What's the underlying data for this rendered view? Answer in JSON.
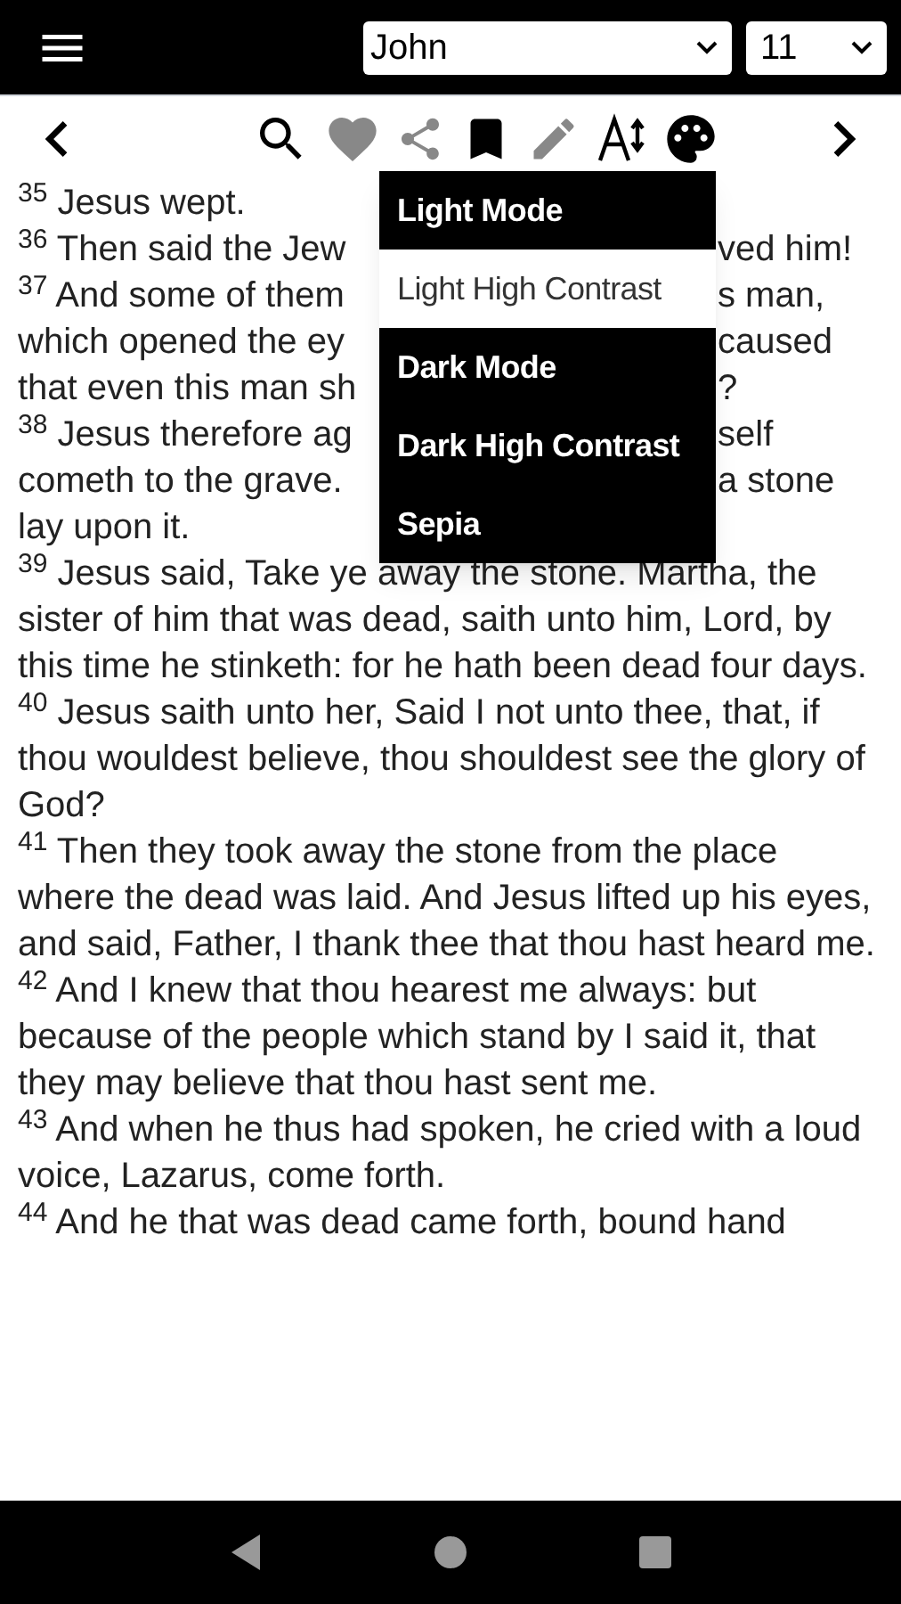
{
  "header": {
    "book_select": {
      "value": "John"
    },
    "chapter_select": {
      "value": "11"
    }
  },
  "toolbar": {
    "favorite": {
      "on": false
    },
    "bookmark": {
      "on": true
    }
  },
  "theme_menu": {
    "items": [
      {
        "label": "Light Mode",
        "selected": false
      },
      {
        "label": "Light High Contrast",
        "selected": true
      },
      {
        "label": "Dark Mode",
        "selected": false
      },
      {
        "label": "Dark High Contrast",
        "selected": false
      },
      {
        "label": "Sepia",
        "selected": false
      }
    ]
  },
  "verses": [
    {
      "kind": "full",
      "text": "$^{35}$ Jesus wept."
    },
    {
      "kind": "covered",
      "lines": [
        {
          "left": "$^{36}$ Then said the Jew",
          "right": "ved him!"
        }
      ]
    },
    {
      "kind": "covered",
      "lines": [
        {
          "left": "$^{37}$ And some of them",
          "right": "s man,"
        },
        {
          "left": "which opened the ey",
          "right": "caused"
        },
        {
          "left": "that even this man sh",
          "right": "?"
        }
      ]
    },
    {
      "kind": "covered",
      "lines": [
        {
          "left": "$^{38}$ Jesus therefore ag",
          "right": "self"
        },
        {
          "left": "cometh to the grave.",
          "right": "a stone"
        },
        {
          "left": "lay upon it."
        }
      ]
    },
    {
      "kind": "full",
      "text": "$^{39}$ Jesus said, Take ye away the stone. Martha, the sister of him that was dead, saith unto him, Lord, by this time he stinketh: for he hath been dead four days."
    },
    {
      "kind": "full",
      "text": "$^{40}$ Jesus saith unto her, Said I not unto thee, that, if thou wouldest believe, thou shouldest see the glory of God?"
    },
    {
      "kind": "full",
      "text": "$^{41}$ Then they took away the stone from the place where the dead was laid. And Jesus lifted up his eyes, and said, Father, I thank thee that thou hast heard me."
    },
    {
      "kind": "full",
      "text": "$^{42}$ And I knew that thou hearest me always: but because of the people which stand by I said it, that they may believe that thou hast sent me."
    },
    {
      "kind": "full",
      "text": "$^{43}$ And when he thus had spoken, he cried with a loud voice, Lazarus, come forth."
    },
    {
      "kind": "full",
      "text": "$^{44}$ And he that was dead came forth, bound hand"
    }
  ]
}
